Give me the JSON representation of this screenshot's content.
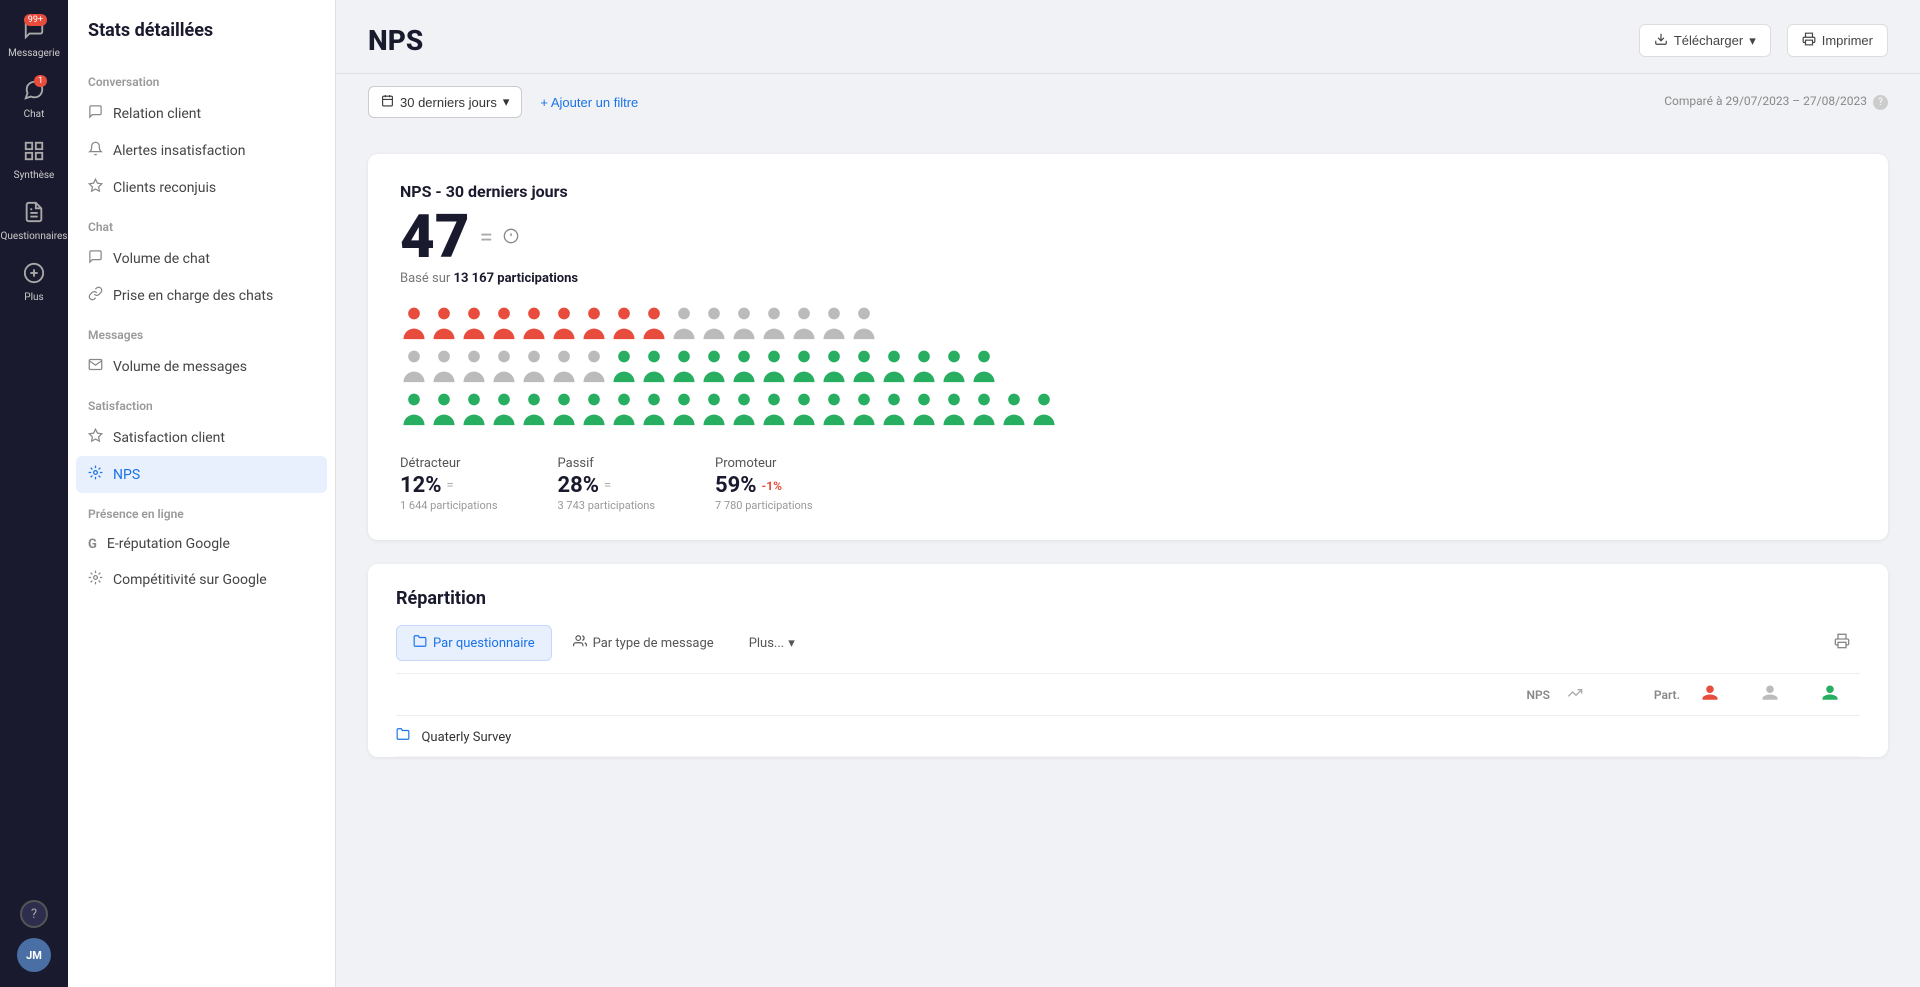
{
  "app": {
    "title": "Stats détaillées"
  },
  "iconBar": {
    "items": [
      {
        "id": "messagerie",
        "label": "Messagerie",
        "icon": "💬",
        "badge": "99+",
        "active": false
      },
      {
        "id": "chat",
        "label": "Chat",
        "icon": "🗨️",
        "badge": "1",
        "active": false
      },
      {
        "id": "synthese",
        "label": "Synthèse",
        "icon": "⊞",
        "active": false
      },
      {
        "id": "questionnaires",
        "label": "Questionnaires",
        "icon": "📋",
        "active": false
      },
      {
        "id": "plus",
        "label": "Plus",
        "icon": "⊕",
        "active": false
      }
    ],
    "help": "?",
    "avatar": "JM"
  },
  "sidebar": {
    "title": "Stats détaillées",
    "sections": [
      {
        "label": "Conversation",
        "items": [
          {
            "id": "relation-client",
            "label": "Relation client",
            "icon": "💬"
          },
          {
            "id": "alertes",
            "label": "Alertes insatisfaction",
            "icon": "🔔"
          },
          {
            "id": "clients",
            "label": "Clients reconjuis",
            "icon": "⭐"
          }
        ]
      },
      {
        "label": "Chat",
        "items": [
          {
            "id": "volume-chat",
            "label": "Volume de chat",
            "icon": "💬"
          },
          {
            "id": "prise-en-charge",
            "label": "Prise en charge des chats",
            "icon": "🔗"
          }
        ]
      },
      {
        "label": "Messages",
        "items": [
          {
            "id": "volume-messages",
            "label": "Volume de messages",
            "icon": "✉️"
          }
        ]
      },
      {
        "label": "Satisfaction",
        "items": [
          {
            "id": "satisfaction-client",
            "label": "Satisfaction client",
            "icon": "☆"
          },
          {
            "id": "nps",
            "label": "NPS",
            "icon": "⚙️",
            "active": true
          }
        ]
      },
      {
        "label": "Présence en ligne",
        "items": [
          {
            "id": "e-reputation",
            "label": "E-réputation Google",
            "icon": "G"
          },
          {
            "id": "competitivite",
            "label": "Compétitivité sur Google",
            "icon": "⚙️"
          }
        ]
      }
    ]
  },
  "header": {
    "title": "NPS",
    "actions": {
      "download": "Télécharger",
      "print": "Imprimer"
    }
  },
  "filters": {
    "dateRange": "30 derniers jours",
    "addFilter": "+ Ajouter un filtre",
    "compareText": "Comparé à 29/07/2023 – 27/08/2023"
  },
  "npsCard": {
    "title": "NPS - 30 derniers jours",
    "score": "47",
    "basedOn": "Basé sur",
    "participations": "13 167 participations",
    "people": {
      "red": 9,
      "gray": 14,
      "green": 35
    },
    "breakdown": {
      "detracteur": {
        "label": "Détracteur",
        "value": "12%",
        "participations": "1 644 participations"
      },
      "passif": {
        "label": "Passif",
        "value": "28%",
        "participations": "3 743 participations"
      },
      "promoteur": {
        "label": "Promoteur",
        "value": "59%",
        "change": "-1%",
        "participations": "7 780 participations"
      }
    }
  },
  "repartition": {
    "title": "Répartition",
    "tabs": [
      {
        "id": "par-questionnaire",
        "label": "Par questionnaire",
        "active": true,
        "icon": "🗂️"
      },
      {
        "id": "par-type-message",
        "label": "Par type de message",
        "active": false,
        "icon": "👥"
      }
    ],
    "plusLabel": "Plus...",
    "tableHeaders": {
      "nps": "NPS",
      "trend": "↗",
      "part": "Part.",
      "det": "👤",
      "pas": "👤",
      "pro": "👤"
    },
    "rows": [
      {
        "name": "Quaterly Survey",
        "icon": "🗂️"
      }
    ]
  }
}
